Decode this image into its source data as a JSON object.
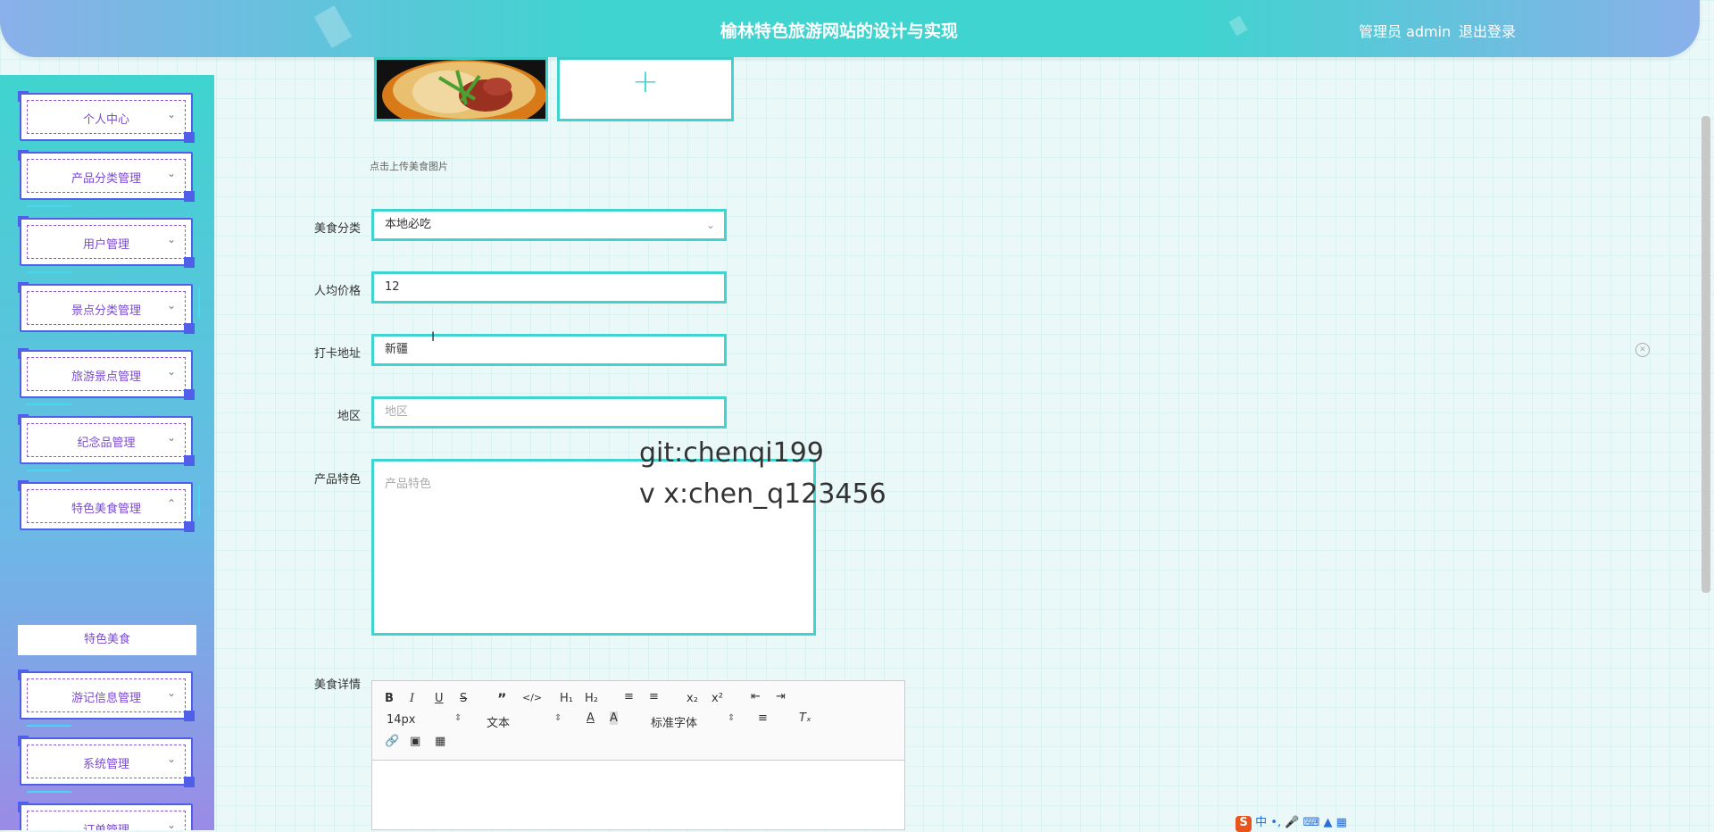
{
  "header": {
    "title": "榆林特色旅游网站的设计与实现",
    "user": "管理员 admin",
    "logout": "退出登录"
  },
  "sidebar": {
    "items": [
      {
        "label": "个人中心"
      },
      {
        "label": "产品分类管理"
      },
      {
        "label": "用户管理"
      },
      {
        "label": "景点分类管理"
      },
      {
        "label": "旅游景点管理"
      },
      {
        "label": "纪念品管理"
      },
      {
        "label": "特色美食管理"
      },
      {
        "label": "游记信息管理"
      },
      {
        "label": "系统管理"
      },
      {
        "label": "订单管理"
      }
    ],
    "submenu": {
      "label": "特色美食"
    }
  },
  "form": {
    "upload_hint": "点击上传美食图片",
    "category": {
      "label": "美食分类",
      "value": "本地必吃"
    },
    "price": {
      "label": "人均价格",
      "value": "12"
    },
    "address": {
      "label": "打卡地址",
      "value": "新疆"
    },
    "region": {
      "label": "地区",
      "placeholder": "地区"
    },
    "feature": {
      "label": "产品特色",
      "placeholder": "产品特色"
    },
    "detail": {
      "label": "美食详情"
    }
  },
  "watermark": {
    "line1": "git:chenqi199",
    "line2": "v x:chen_q123456"
  },
  "editor": {
    "font_size": "14px",
    "text_type": "文本",
    "font_family": "标准字体"
  },
  "ime": {
    "label": "中"
  }
}
